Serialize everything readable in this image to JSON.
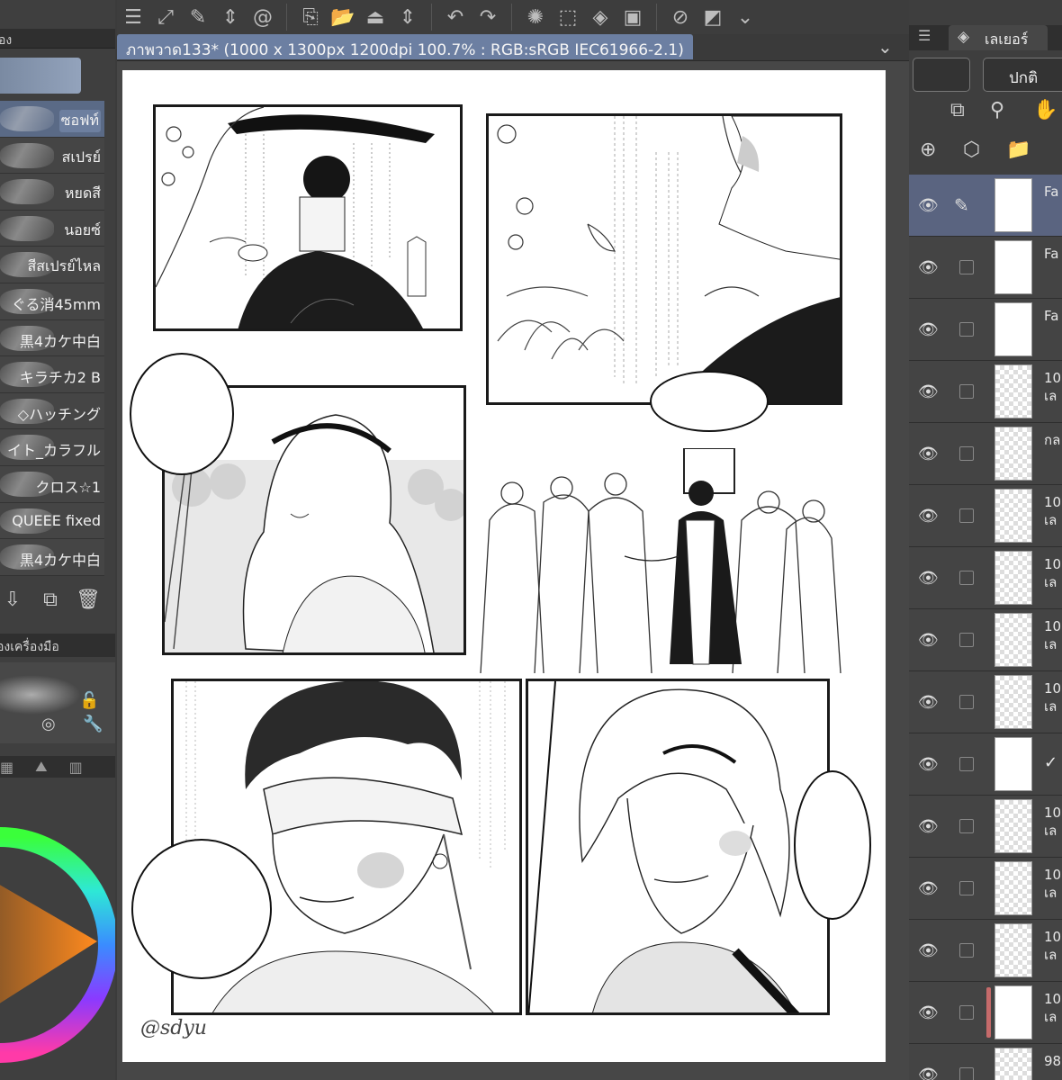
{
  "document": {
    "tab_title": "ภาพวาด133* (1000 x 1300px 1200dpi 100.7% : RGB:sRGB IEC61966-2.1)",
    "signature": "@sdyu"
  },
  "left_panel": {
    "header_fragment": "อง",
    "brushes": [
      {
        "label": "ซอฟท์",
        "active": true
      },
      {
        "label": "สเปรย์",
        "active": false
      },
      {
        "label": "หยดสี",
        "active": false
      },
      {
        "label": "นอยซ์",
        "active": false
      },
      {
        "label": "สีสเปรย์ไหล",
        "active": false
      },
      {
        "label": "ぐる消45mm",
        "active": false
      },
      {
        "label": "黒4カケ中白",
        "active": false
      },
      {
        "label": "キラチカ2 B",
        "active": false
      },
      {
        "label": "◇ハッチング",
        "active": false
      },
      {
        "label": "イト_カラフル",
        "active": false
      },
      {
        "label": "クロス☆1",
        "active": false
      },
      {
        "label": "QUEEE fixed",
        "active": false
      },
      {
        "label": "黒4カケ中白",
        "active": false
      }
    ],
    "tool_property_tab": "องเครื่องมือ"
  },
  "right_panel": {
    "tab_label": "เลเยอร์",
    "blend_mode": "ปกติ",
    "layers": [
      {
        "name": "Fa",
        "sub": "",
        "thumb": "lineart",
        "selected": true,
        "edit": true
      },
      {
        "name": "Fa",
        "sub": "",
        "thumb": "lineart",
        "selected": false,
        "edit": false
      },
      {
        "name": "Fa",
        "sub": "",
        "thumb": "lineart",
        "selected": false,
        "edit": false
      },
      {
        "name": "10",
        "sub": "เล",
        "thumb": "transparent",
        "selected": false,
        "edit": false
      },
      {
        "name": "กล",
        "sub": "",
        "thumb": "transparent",
        "selected": false,
        "edit": false
      },
      {
        "name": "10",
        "sub": "เล",
        "thumb": "transparent",
        "selected": false,
        "edit": false
      },
      {
        "name": "10",
        "sub": "เล",
        "thumb": "transparent",
        "selected": false,
        "edit": false
      },
      {
        "name": "10",
        "sub": "เล",
        "thumb": "transparent",
        "selected": false,
        "edit": false
      },
      {
        "name": "10",
        "sub": "เล",
        "thumb": "transparent",
        "selected": false,
        "edit": false
      },
      {
        "name": "",
        "sub": "",
        "thumb": "white",
        "selected": false,
        "edit": false
      },
      {
        "name": "10",
        "sub": "เล",
        "thumb": "transparent",
        "selected": false,
        "edit": false
      },
      {
        "name": "10",
        "sub": "เล",
        "thumb": "transparent",
        "selected": false,
        "edit": false
      },
      {
        "name": "10",
        "sub": "เล",
        "thumb": "transparent",
        "selected": false,
        "edit": false
      },
      {
        "name": "10",
        "sub": "เล",
        "thumb": "white",
        "selected": false,
        "edit": false
      },
      {
        "name": "98",
        "sub": "",
        "thumb": "transparent",
        "selected": false,
        "edit": false
      }
    ]
  },
  "colors": {
    "doc_tab": "#6c7fa2",
    "selected_brush": "#5a6a86",
    "selected_layer": "#5a6480",
    "panel_bg": "#3e3e3e"
  }
}
